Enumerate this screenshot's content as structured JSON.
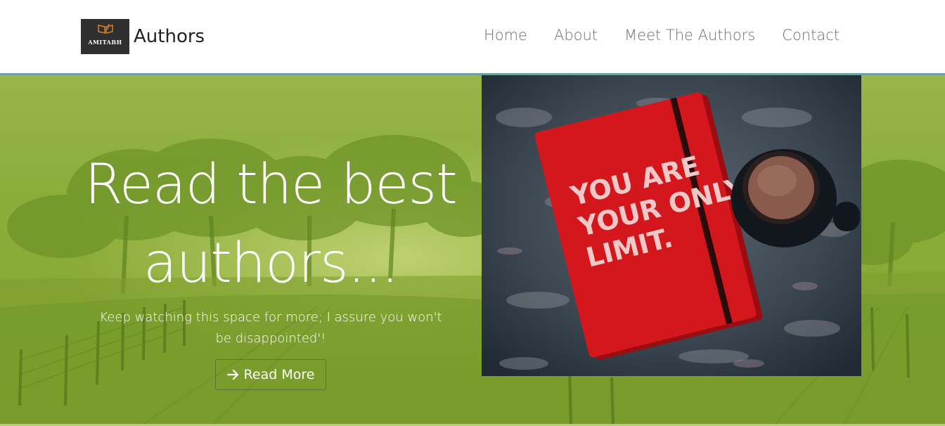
{
  "brand": {
    "logo_text": "AMITABH",
    "name": "Authors"
  },
  "nav": {
    "items": [
      "Home",
      "About",
      "Meet The Authors",
      "Contact"
    ]
  },
  "hero": {
    "title_line1": "Read the best",
    "title_line2": "authors...",
    "subtitle": "Keep watching this space for more; I assure you won't be disappointed'!",
    "button_label": "Read More",
    "image_text": [
      "YOU ARE",
      "YOUR ONLY",
      "LIMIT."
    ]
  },
  "colors": {
    "hero_green": "#8aad3a",
    "notebook_red": "#d4161d",
    "nav_text": "#6e6e6e"
  }
}
